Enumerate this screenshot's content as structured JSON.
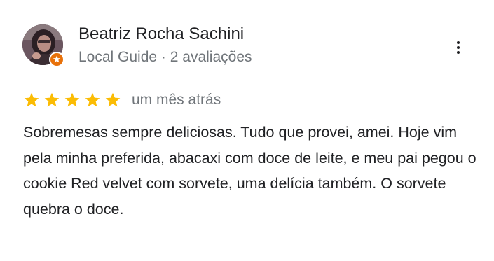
{
  "reviewer": {
    "name": "Beatriz Rocha Sachini",
    "badge": "Local Guide",
    "separator": "·",
    "reviews_count": "2 avaliações",
    "avatar_icon": "avatar-photo",
    "badge_icon": "local-guide-star-badge",
    "badge_color": "#e8710a"
  },
  "menu": {
    "icon": "more-vert-icon"
  },
  "rating": {
    "value": 5,
    "max": 5,
    "star_color": "#fbbc04",
    "date": "um mês atrás"
  },
  "review": {
    "text": "Sobremesas sempre deliciosas. Tudo que provei, amei. Hoje vim pela minha preferida, abacaxi com doce de leite, e meu pai pegou o cookie Red velvet com sorvete, uma delícia também. O sorvete quebra o doce."
  }
}
